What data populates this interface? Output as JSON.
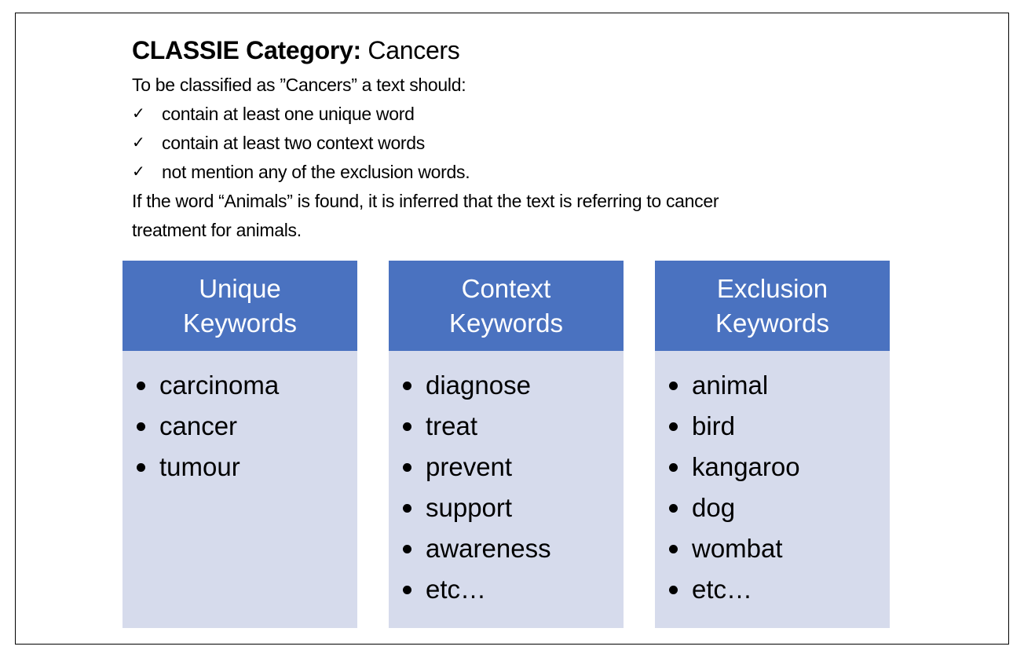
{
  "title": {
    "bold": "CLASSIE Category:",
    "rest": " Cancers"
  },
  "intro": "To be classified as ”Cancers” a text should:",
  "criteria": [
    "contain at least one unique word",
    "contain at least two context words",
    "not mention any of the exclusion words."
  ],
  "check_icon": "✓",
  "note_line1": "If the word “Animals” is found, it is inferred that the text is referring to cancer",
  "note_line2": "treatment for animals.",
  "columns": [
    {
      "head1": "Unique",
      "head2": "Keywords",
      "items": [
        "carcinoma",
        "cancer",
        "tumour"
      ]
    },
    {
      "head1": "Context",
      "head2": "Keywords",
      "items": [
        "diagnose",
        "treat",
        "prevent",
        "support",
        "awareness",
        "etc…"
      ]
    },
    {
      "head1": "Exclusion",
      "head2": "Keywords",
      "items": [
        "animal",
        "bird",
        "kangaroo",
        "dog",
        "wombat",
        "etc…"
      ]
    }
  ],
  "colors": {
    "header": "#4a72c0",
    "body": "#d6dbec"
  }
}
